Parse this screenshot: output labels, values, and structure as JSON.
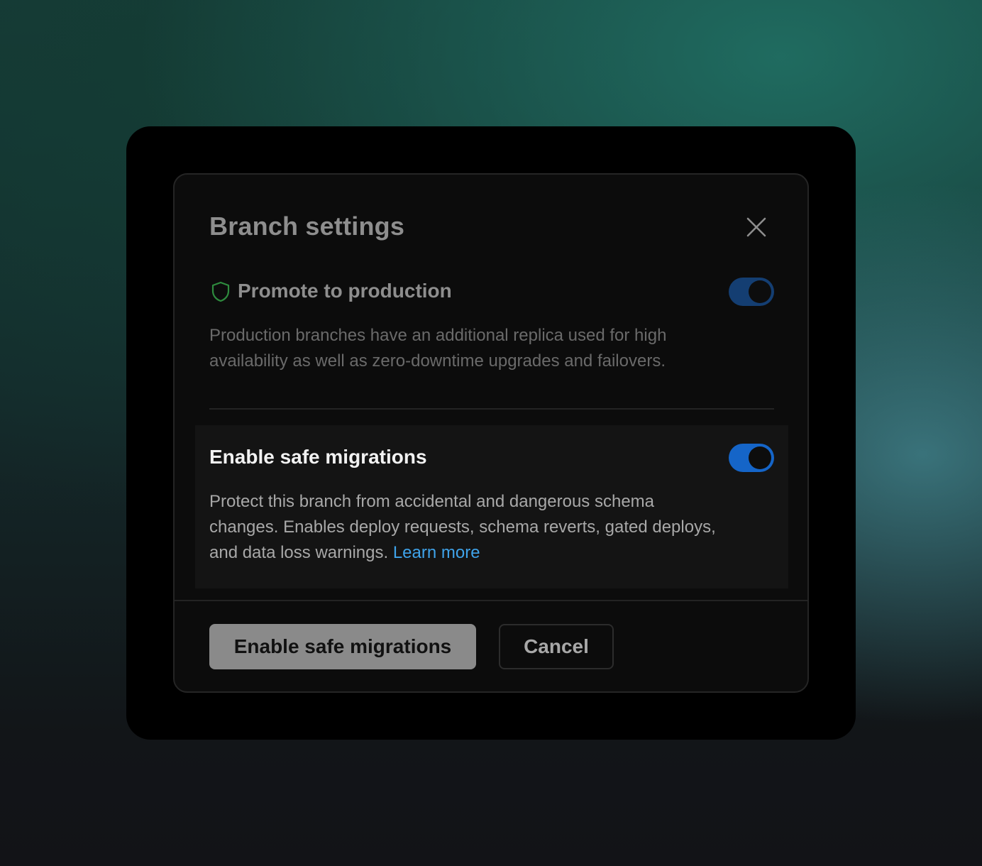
{
  "dialog": {
    "title": "Branch settings",
    "close_icon": "close-icon"
  },
  "promote": {
    "icon": "shield-icon",
    "title": "Promote to production",
    "description": "Production branches have an additional replica used for high availability as well as zero-downtime upgrades and failovers.",
    "enabled": true
  },
  "safe_migrations": {
    "title": "Enable safe migrations",
    "description": "Protect this branch from accidental and dangerous schema changes. Enables deploy requests, schema reverts, gated deploys, and data loss warnings.",
    "learn_more": "Learn more",
    "enabled": true
  },
  "footer": {
    "primary_label": "Enable safe migrations",
    "cancel_label": "Cancel"
  },
  "colors": {
    "toggle_on": "#1565c8",
    "toggle_dimmed": "#143e72",
    "link": "#3fa3ea",
    "shield": "#2e8b3e"
  }
}
